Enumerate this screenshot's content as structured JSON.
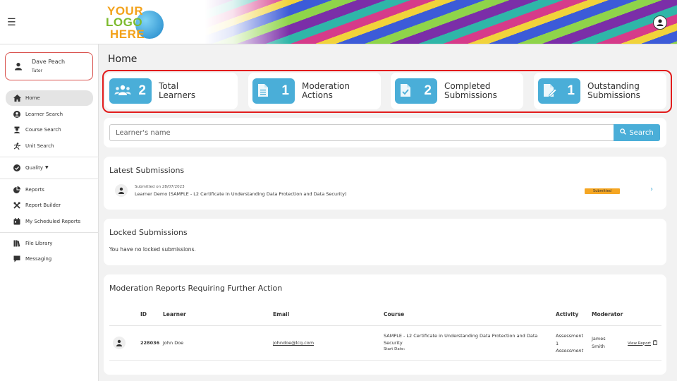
{
  "header": {
    "logo_line1": "YOUR",
    "logo_line2": "LOGO",
    "logo_line3": "HERE"
  },
  "user": {
    "name": "Dave Peach",
    "role": "Tutor"
  },
  "sidebar": {
    "items": [
      {
        "label": "Home",
        "icon": "home-icon",
        "active": true
      },
      {
        "label": "Learner Search",
        "icon": "user-circle-icon"
      },
      {
        "label": "Course Search",
        "icon": "graduation-cap-icon"
      },
      {
        "label": "Unit Search",
        "icon": "unit-icon"
      },
      {
        "label": "Quality",
        "icon": "check-circle-icon"
      },
      {
        "label": "Reports",
        "icon": "pie-chart-icon"
      },
      {
        "label": "Report Builder",
        "icon": "tools-icon"
      },
      {
        "label": "My Scheduled Reports",
        "icon": "calendar-icon"
      },
      {
        "label": "File Library",
        "icon": "books-icon"
      },
      {
        "label": "Messaging",
        "icon": "comment-icon"
      }
    ]
  },
  "page": {
    "title": "Home"
  },
  "stats": [
    {
      "value": "2",
      "label_line1": "Total",
      "label_line2": "Learners",
      "icon": "users-icon"
    },
    {
      "value": "1",
      "label_line1": "Moderation",
      "label_line2": "Actions",
      "icon": "document-icon"
    },
    {
      "value": "2",
      "label_line1": "Completed",
      "label_line2": "Submissions",
      "icon": "document-check-icon"
    },
    {
      "value": "1",
      "label_line1": "Outstanding",
      "label_line2": "Submissions",
      "icon": "document-pen-icon"
    }
  ],
  "search": {
    "placeholder": "Learner's name",
    "button_label": "Search"
  },
  "latest_submissions": {
    "title": "Latest Submissions",
    "items": [
      {
        "date": "Submitted on 28/07/2023",
        "description": "Learner Demo (SAMPLE - L2 Certificate in Understanding Data Protection and Data Security)",
        "status": "Submitted"
      }
    ]
  },
  "locked_submissions": {
    "title": "Locked Submissions",
    "message": "You have no locked submissions."
  },
  "moderation": {
    "title": "Moderation Reports Requiring Further Action",
    "columns": [
      "ID",
      "Learner",
      "Email",
      "Course",
      "Activity",
      "Moderator"
    ],
    "rows": [
      {
        "id": "228036",
        "learner": "John Doe",
        "email": "johndoe@lcg.com",
        "course_line1": "SAMPLE - L2 Certificate in Understanding Data Protection and Data",
        "course_line2": "Security",
        "start_date": "Start Date:",
        "activity_line1": "Assessment",
        "activity_line2": "1",
        "activity_line3": "Assessment",
        "moderator_line1": "James",
        "moderator_line2": "Smith",
        "action": "View Report"
      }
    ]
  },
  "colors": {
    "accent": "#4aaed8",
    "highlight_border": "#e21c1c",
    "status_badge": "#f5a623"
  }
}
